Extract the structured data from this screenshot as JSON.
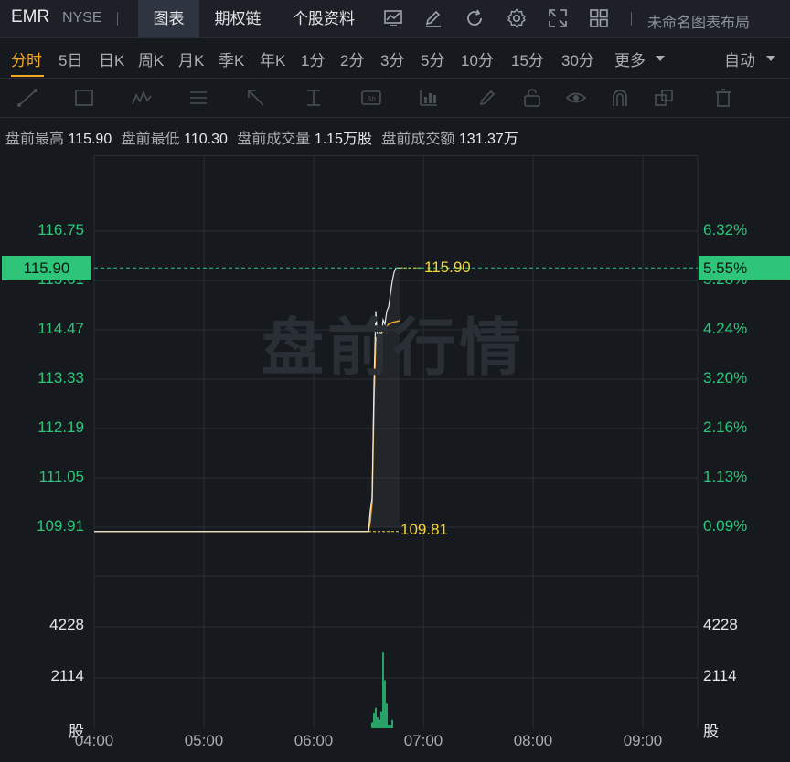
{
  "header": {
    "symbol": "EMR",
    "exchange": "NYSE",
    "tabs": [
      {
        "label": "图表",
        "active": true
      },
      {
        "label": "期权链",
        "active": false
      },
      {
        "label": "个股资料",
        "active": false
      }
    ],
    "layout_name": "未命名图表布局",
    "icons": [
      "indicator-chart-icon",
      "edit-pen-icon",
      "refresh-icon",
      "settings-gear-icon",
      "fullscreen-expand-icon",
      "layout-grid-icon"
    ]
  },
  "timeframes": {
    "items": [
      "分时",
      "5日",
      "日K",
      "周K",
      "月K",
      "季K",
      "年K",
      "1分",
      "2分",
      "3分",
      "5分",
      "10分",
      "15分",
      "30分",
      "更多"
    ],
    "active": "分时",
    "auto_label": "自动"
  },
  "drawing_tools": [
    "line-tool-icon",
    "rectangle-tool-icon",
    "wave-pattern-icon",
    "fibonacci-icon",
    "arrow-tool-icon",
    "measure-tool-icon",
    "text-tool-icon",
    "indicator-overlay-icon",
    "brush-icon",
    "lock-icon",
    "eye-icon",
    "magnet-icon",
    "clone-icon",
    "delete-trash-icon"
  ],
  "premarket": {
    "high_label": "盘前最高",
    "high_value": "115.90",
    "low_label": "盘前最低",
    "low_value": "110.30",
    "volume_label": "盘前成交量",
    "volume_value": "1.15万股",
    "amount_label": "盘前成交额",
    "amount_value": "131.37万"
  },
  "watermark": "盘前行情",
  "current_price": {
    "price": "115.90",
    "percent": "5.55%"
  },
  "colors": {
    "up": "#2ec47a",
    "accent": "#f5a623",
    "price_line": "#e6e8eb",
    "avg_line": "#f5a623",
    "marker": "#f5d33a"
  },
  "chart_data": {
    "type": "line",
    "x_ticks": [
      "04:00",
      "05:00",
      "06:00",
      "07:00",
      "08:00",
      "09:00"
    ],
    "price_ticks": [
      "116.75",
      "115.61",
      "114.47",
      "113.33",
      "112.19",
      "111.05",
      "109.91"
    ],
    "percent_ticks": [
      "6.32%",
      "5.28%",
      "4.24%",
      "3.20%",
      "2.16%",
      "1.13%",
      "0.09%"
    ],
    "volume_ticks": [
      "4228",
      "2114",
      "股"
    ],
    "ylim": [
      109.91,
      116.75
    ],
    "xlim_minutes": [
      0,
      330
    ],
    "high_marker": "115.90",
    "low_marker": "109.81",
    "price_series": {
      "minute": [
        0,
        150,
        151,
        152,
        153,
        154,
        155,
        156,
        157,
        158,
        159,
        160,
        161,
        162,
        163,
        164,
        165,
        166,
        167
      ],
      "value": [
        109.81,
        109.81,
        110.3,
        110.6,
        113.2,
        114.9,
        114.2,
        114.5,
        114.3,
        114.7,
        114.6,
        114.9,
        115.0,
        115.3,
        115.6,
        115.8,
        115.9,
        115.9,
        115.9
      ]
    },
    "avg_series": {
      "minute": [
        0,
        150,
        151,
        152,
        153,
        154,
        155,
        156,
        157,
        158,
        159,
        160,
        161,
        162,
        163,
        164,
        165,
        166,
        167
      ],
      "value": [
        109.81,
        109.81,
        110.05,
        110.5,
        112.8,
        114.3,
        114.2,
        114.35,
        114.4,
        114.45,
        114.5,
        114.55,
        114.6,
        114.62,
        114.64,
        114.65,
        114.66,
        114.67,
        114.68
      ]
    },
    "volume_series": {
      "minute": [
        152,
        153,
        154,
        155,
        156,
        157,
        158,
        159,
        160,
        161,
        162,
        163
      ],
      "value": [
        250,
        650,
        850,
        450,
        350,
        700,
        3150,
        2000,
        1050,
        150,
        150,
        350
      ]
    },
    "volume_max": 4228
  }
}
